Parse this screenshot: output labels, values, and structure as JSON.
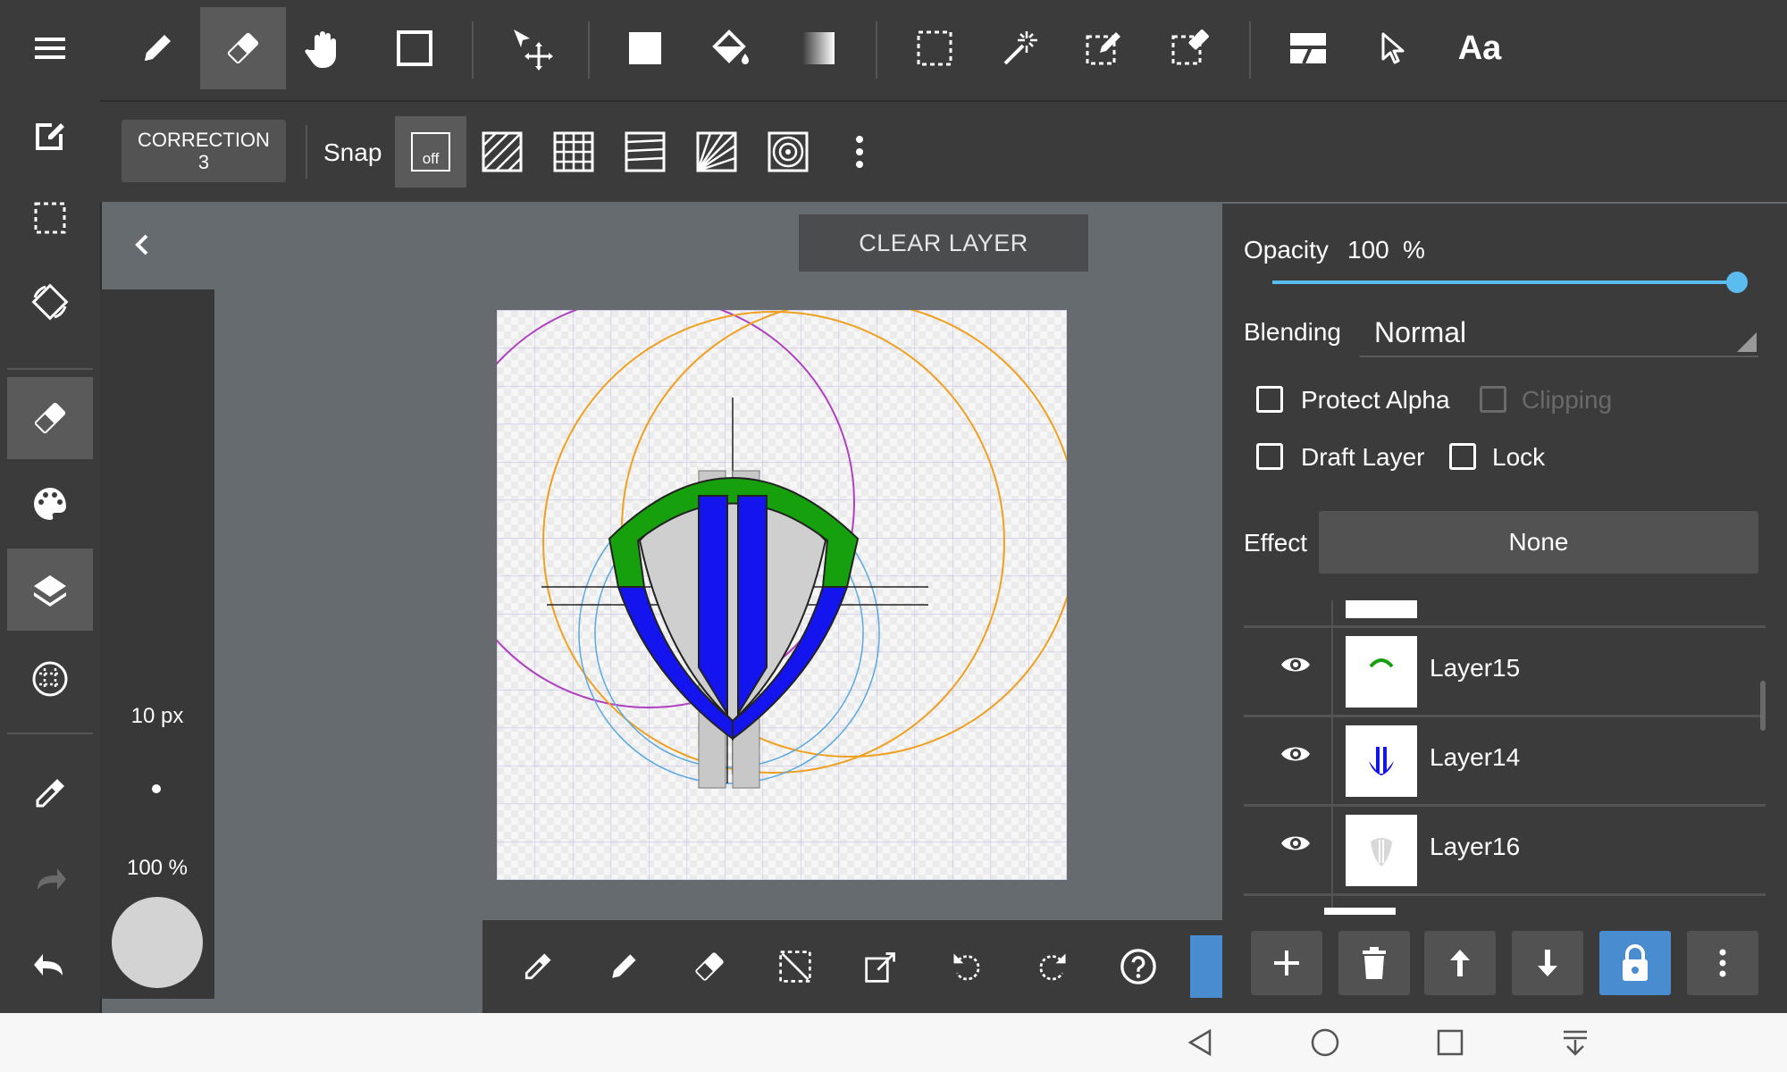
{
  "toolbar": {
    "tools": [
      "pen-icon",
      "eraser-icon",
      "hand-icon",
      "rectangle-icon",
      "move-icon",
      "fill-rect-icon",
      "bucket-icon",
      "gradient-icon",
      "select-rect-icon",
      "magic-wand-icon",
      "select-pen-icon",
      "select-eraser-icon",
      "frame-icon",
      "pointer-icon",
      "text-icon"
    ],
    "text_tool_label": "Aa",
    "active_tool": "eraser"
  },
  "subbar": {
    "correction_label": "CORRECTION",
    "correction_value": "3",
    "snap_label": "Snap",
    "snap_off_label": "off"
  },
  "canvas_header": {
    "clear_layer_label": "CLEAR LAYER"
  },
  "brush": {
    "size": "10 px",
    "opacity": "100 %"
  },
  "layer_props": {
    "opacity_label": "Opacity",
    "opacity_value": "100",
    "opacity_unit": "%",
    "opacity_fraction": 1.0,
    "blending_label": "Blending",
    "blending_value": "Normal",
    "protect_alpha_label": "Protect Alpha",
    "clipping_label": "Clipping",
    "draft_layer_label": "Draft Layer",
    "lock_label": "Lock",
    "effect_label": "Effect",
    "effect_value": "None"
  },
  "layers": [
    {
      "name": "Layer15",
      "visible": true
    },
    {
      "name": "Layer14",
      "visible": true
    },
    {
      "name": "Layer16",
      "visible": true
    }
  ],
  "colors": {
    "accent": "#4a8cd0",
    "slider": "#5bbcf0",
    "shield_green": "#17a00e",
    "shield_blue": "#1414ee"
  }
}
